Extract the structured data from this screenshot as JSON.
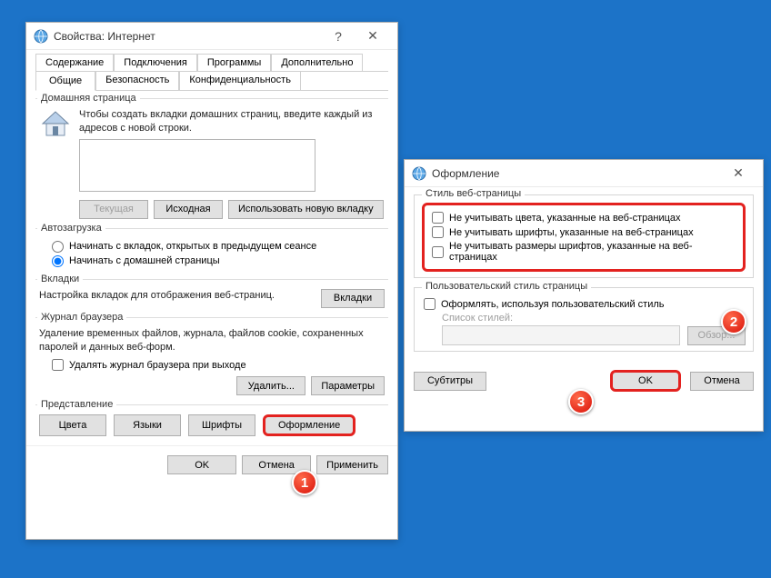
{
  "mainWindow": {
    "title": "Свойства: Интернет",
    "tabsRow1": [
      "Содержание",
      "Подключения",
      "Программы",
      "Дополнительно"
    ],
    "tabsRow2": [
      "Общие",
      "Безопасность",
      "Конфиденциальность"
    ],
    "activeTab": "Общие",
    "homepage": {
      "title": "Домашняя страница",
      "hint": "Чтобы создать вкладки домашних страниц, введите каждый из адресов с новой строки.",
      "value": "",
      "btnCurrent": "Текущая",
      "btnDefault": "Исходная",
      "btnNewTab": "Использовать новую вкладку"
    },
    "autoload": {
      "title": "Автозагрузка",
      "radio1": "Начинать с вкладок, открытых в предыдущем сеансе",
      "radio2": "Начинать с домашней страницы",
      "selected": 2
    },
    "tabs": {
      "title": "Вкладки",
      "text": "Настройка вкладок для отображения веб-страниц.",
      "btn": "Вкладки"
    },
    "history": {
      "title": "Журнал браузера",
      "text": "Удаление временных файлов, журнала, файлов cookie, сохраненных паролей и данных веб-форм.",
      "chkDeleteOnExit": "Удалять журнал браузера при выходе",
      "btnDelete": "Удалить...",
      "btnSettings": "Параметры"
    },
    "presentation": {
      "title": "Представление",
      "btnColors": "Цвета",
      "btnLanguages": "Языки",
      "btnFonts": "Шрифты",
      "btnAccessibility": "Оформление"
    },
    "footer": {
      "ok": "OK",
      "cancel": "Отмена",
      "apply": "Применить"
    }
  },
  "accessibilityWindow": {
    "title": "Оформление",
    "styleGroup": {
      "title": "Стиль веб-страницы",
      "chk1": "Не учитывать цвета, указанные на веб-страницах",
      "chk2": "Не учитывать шрифты, указанные на веб-страницах",
      "chk3": "Не учитывать размеры шрифтов, указанные на веб-страницах"
    },
    "userStyleGroup": {
      "title": "Пользовательский стиль страницы",
      "chk": "Оформлять, используя пользовательский стиль",
      "listLabel": "Список стилей:",
      "browse": "Обзор..."
    },
    "btnSubtitles": "Субтитры",
    "ok": "OK",
    "cancel": "Отмена"
  },
  "markers": {
    "m1": "1",
    "m2": "2",
    "m3": "3"
  }
}
